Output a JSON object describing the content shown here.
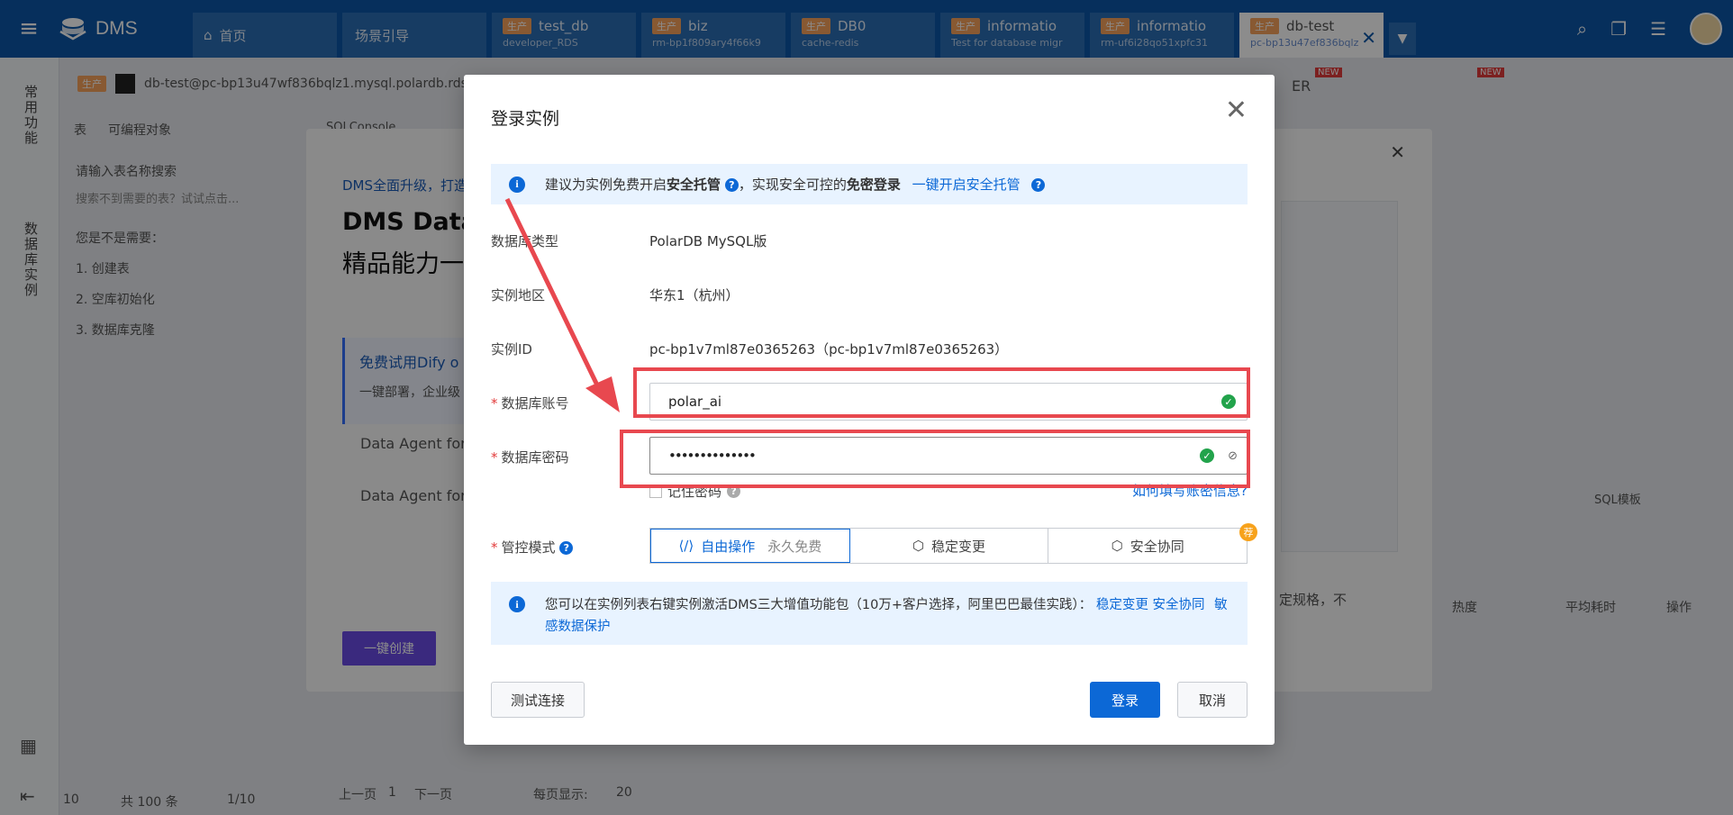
{
  "app": {
    "logo": "DMS"
  },
  "tabs": [
    {
      "label": "首页",
      "type": "plain",
      "icon": "home-icon"
    },
    {
      "label": "场景引导",
      "type": "plain"
    },
    {
      "tag": "生产",
      "title": "test_db",
      "subtitle": "developer_RDS"
    },
    {
      "tag": "生产",
      "title": "biz",
      "subtitle": "rm-bp1f809ary4f66k9"
    },
    {
      "tag": "生产",
      "title": "DB0",
      "subtitle": "cache-redis"
    },
    {
      "tag": "生产",
      "title": "informatio",
      "subtitle": "Test for database migr"
    },
    {
      "tag": "生产",
      "title": "informatio",
      "subtitle": "rm-uf6i28qo51xpfc31"
    },
    {
      "tag": "生产",
      "title": "db-test",
      "subtitle": "pc-bp13u47ef836bqlz",
      "active": true
    }
  ],
  "left_rail": {
    "common": "常用功能",
    "instances": "数据库实例"
  },
  "background": {
    "conn_tag": "生产",
    "conn_text": "db-test@pc-bp13u47wf836bqlz1.mysql.polardb.rds.",
    "tab_table": "表",
    "tab_prog": "可编程对象",
    "search_placeholder": "请输入表名称搜索",
    "search_hint": "搜索不到需要的表？试试点击...",
    "need": "您是不是需要：",
    "item1": "1. 创建表",
    "item2": "2. 空库初始化",
    "item3": "3. 数据库克隆",
    "promo1": "DMS全面升级，打造",
    "promo2": "DMS Data-",
    "promo3": "精品能力一",
    "free": "免费试用Dify o",
    "deploy": "一键部署，企业级",
    "agent1": "Data Agent for",
    "agent2": "Data Agent for",
    "create_btn": "一键创建",
    "sql_template": "SQL模板",
    "hot": "热度",
    "avg": "平均耗时",
    "op": "操作",
    "spec": "定规格，不",
    "pager_size": "10",
    "pager_total": "共 100 条",
    "pager_page": "1/10",
    "prev": "上一页",
    "next": "下一页",
    "page_num": "1",
    "per_page_label": "每页显示:",
    "per_page": "20",
    "sql_console": "SQLConsole",
    "er": "ER",
    "new": "NEW"
  },
  "modal": {
    "title": "登录实例",
    "notice_text_1": "建议为实例免费开启",
    "notice_bold_1": "安全托管",
    "notice_text_2": "，实现安全可控的",
    "notice_bold_2": "免密登录",
    "notice_link": "一键开启安全托管",
    "db_type_label": "数据库类型",
    "db_type_value": "PolarDB MySQL版",
    "region_label": "实例地区",
    "region_value": "华东1（杭州）",
    "instance_label": "实例ID",
    "instance_value": "pc-bp1v7ml87e0365263（pc-bp1v7ml87e0365263）",
    "account_label": "数据库账号",
    "account_value": "polar_ai",
    "password_label": "数据库密码",
    "password_value": "••••••••••••••",
    "remember": "记住密码",
    "help_link": "如何填写账密信息?",
    "mode_label": "管控模式",
    "modes": [
      "自由操作",
      "稳定变更",
      "安全协同"
    ],
    "free_tag": "永久免费",
    "badge": "荐",
    "tip_text": "您可以在实例列表右键实例激活DMS三大增值功能包（10万+客户选择，阿里巴巴最佳实践）：",
    "tip_link1": "稳定变更",
    "tip_link2": "安全协同",
    "tip_link3": "敏感数据保护",
    "test_btn": "测试连接",
    "login_btn": "登录",
    "cancel_btn": "取消"
  },
  "colors": {
    "brand": "#0c57a8",
    "primary": "#0c68d6",
    "annotation": "#e8484f"
  }
}
